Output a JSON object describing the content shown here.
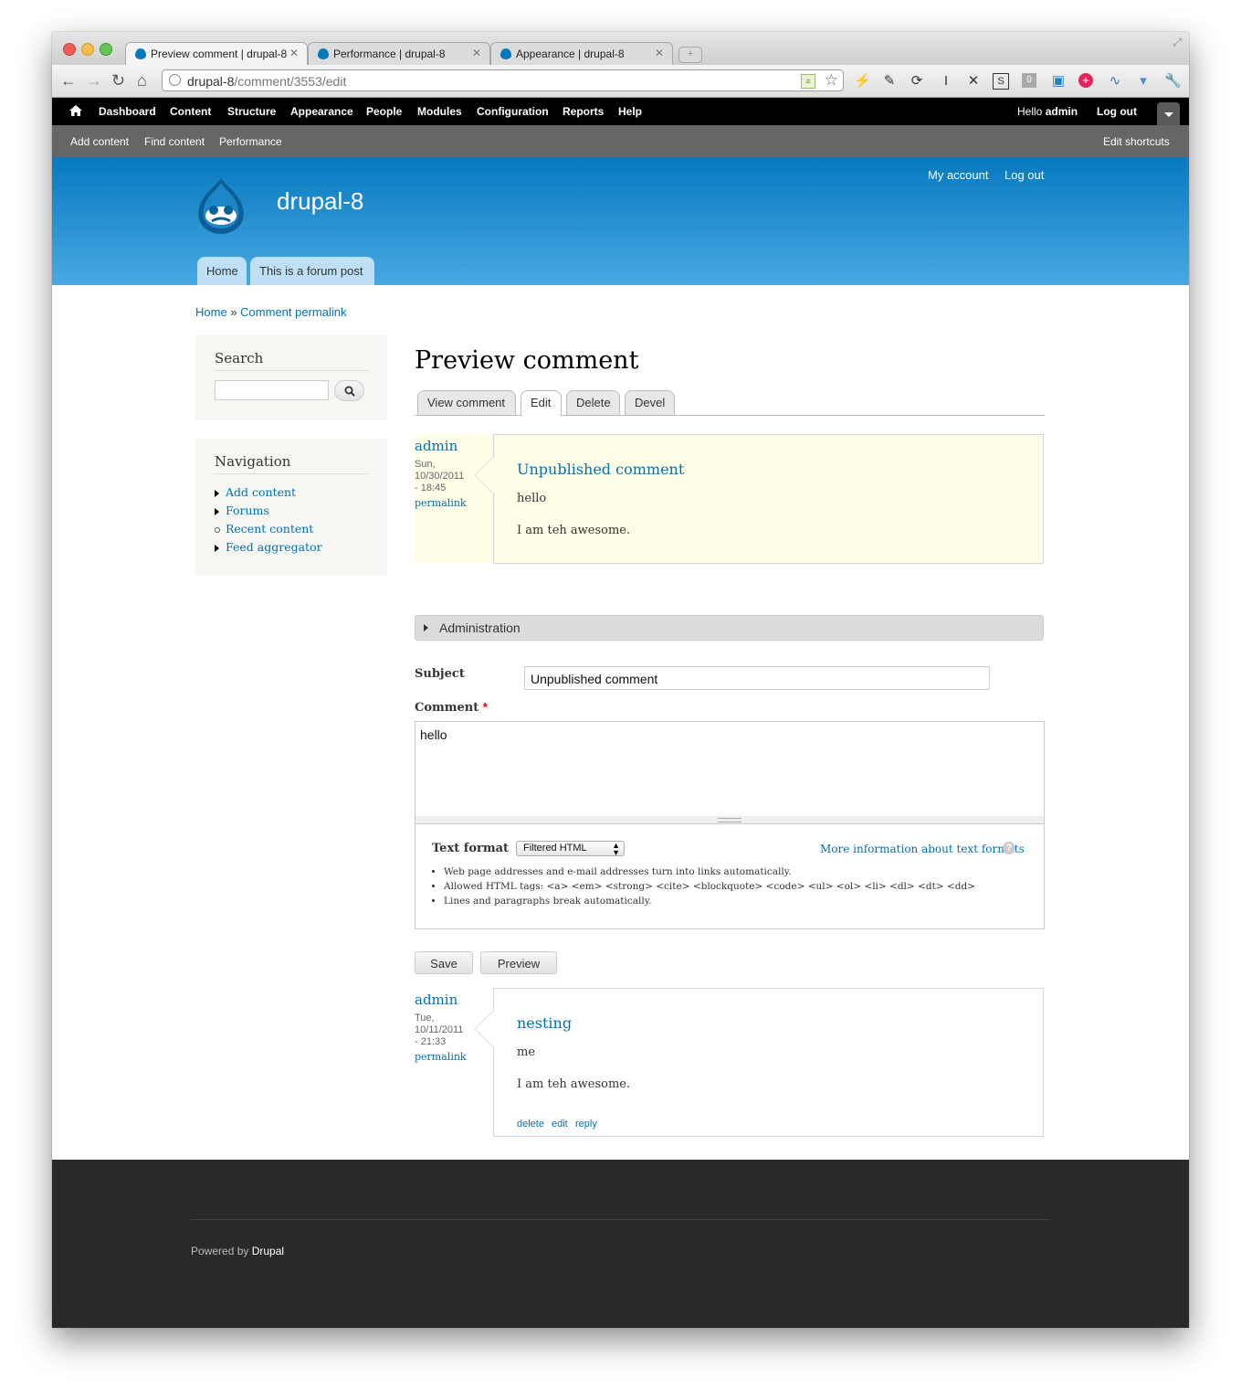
{
  "browser": {
    "tabs": [
      {
        "title": "Preview comment | drupal-8"
      },
      {
        "title": "Performance | drupal-8"
      },
      {
        "title": "Appearance | drupal-8"
      }
    ],
    "url_host": "drupal-8",
    "url_path": "/comment/3553/edit"
  },
  "toolbar": {
    "menu": [
      "Dashboard",
      "Content",
      "Structure",
      "Appearance",
      "People",
      "Modules",
      "Configuration",
      "Reports",
      "Help"
    ],
    "hello": "Hello",
    "user": "admin",
    "logout": "Log out"
  },
  "shortcuts": {
    "items": [
      "Add content",
      "Find content",
      "Performance"
    ],
    "edit": "Edit shortcuts"
  },
  "header": {
    "site_name": "drupal-8",
    "my_account": "My account",
    "log_out": "Log out",
    "tabs": [
      "Home",
      "This is a forum post"
    ]
  },
  "breadcrumb": {
    "home": "Home",
    "sep": "»",
    "current": "Comment permalink"
  },
  "sidebar": {
    "search_title": "Search",
    "nav_title": "Navigation",
    "nav_items": [
      "Add content",
      "Forums",
      "Recent content",
      "Feed aggregator"
    ]
  },
  "main": {
    "title": "Preview comment",
    "tabs": [
      "View comment",
      "Edit",
      "Delete",
      "Devel"
    ],
    "preview": {
      "author": "admin",
      "date_line1": "Sun,",
      "date_line2": "10/30/2011",
      "date_line3": "- 18:45",
      "permalink": "permalink",
      "title": "Unpublished comment",
      "p1": "hello",
      "p2": "I am teh awesome."
    },
    "administration": "Administration",
    "subject_label": "Subject",
    "subject_value": "Unpublished comment",
    "comment_label": "Comment",
    "required_marker": "*",
    "comment_value": "hello",
    "text_format_label": "Text format",
    "text_format_value": "Filtered HTML",
    "more_info": "More information about text formats",
    "tips": [
      "Web page addresses and e-mail addresses turn into links automatically.",
      "Allowed HTML tags: <a> <em> <strong> <cite> <blockquote> <code> <ul> <ol> <li> <dl> <dt> <dd>",
      "Lines and paragraphs break automatically."
    ],
    "save": "Save",
    "preview_btn": "Preview",
    "existing": {
      "author": "admin",
      "date_line1": "Tue,",
      "date_line2": "10/11/2011",
      "date_line3": "- 21:33",
      "permalink": "permalink",
      "title": "nesting",
      "p1": "me",
      "p2": "I am teh awesome.",
      "links": [
        "delete",
        "edit",
        "reply"
      ]
    }
  },
  "footer": {
    "powered": "Powered by",
    "drupal": "Drupal"
  },
  "colors": {
    "link": "#0071b3",
    "header_top": "#0779bf",
    "header_bottom": "#48a9e4",
    "unpublished": "#fffee6"
  }
}
